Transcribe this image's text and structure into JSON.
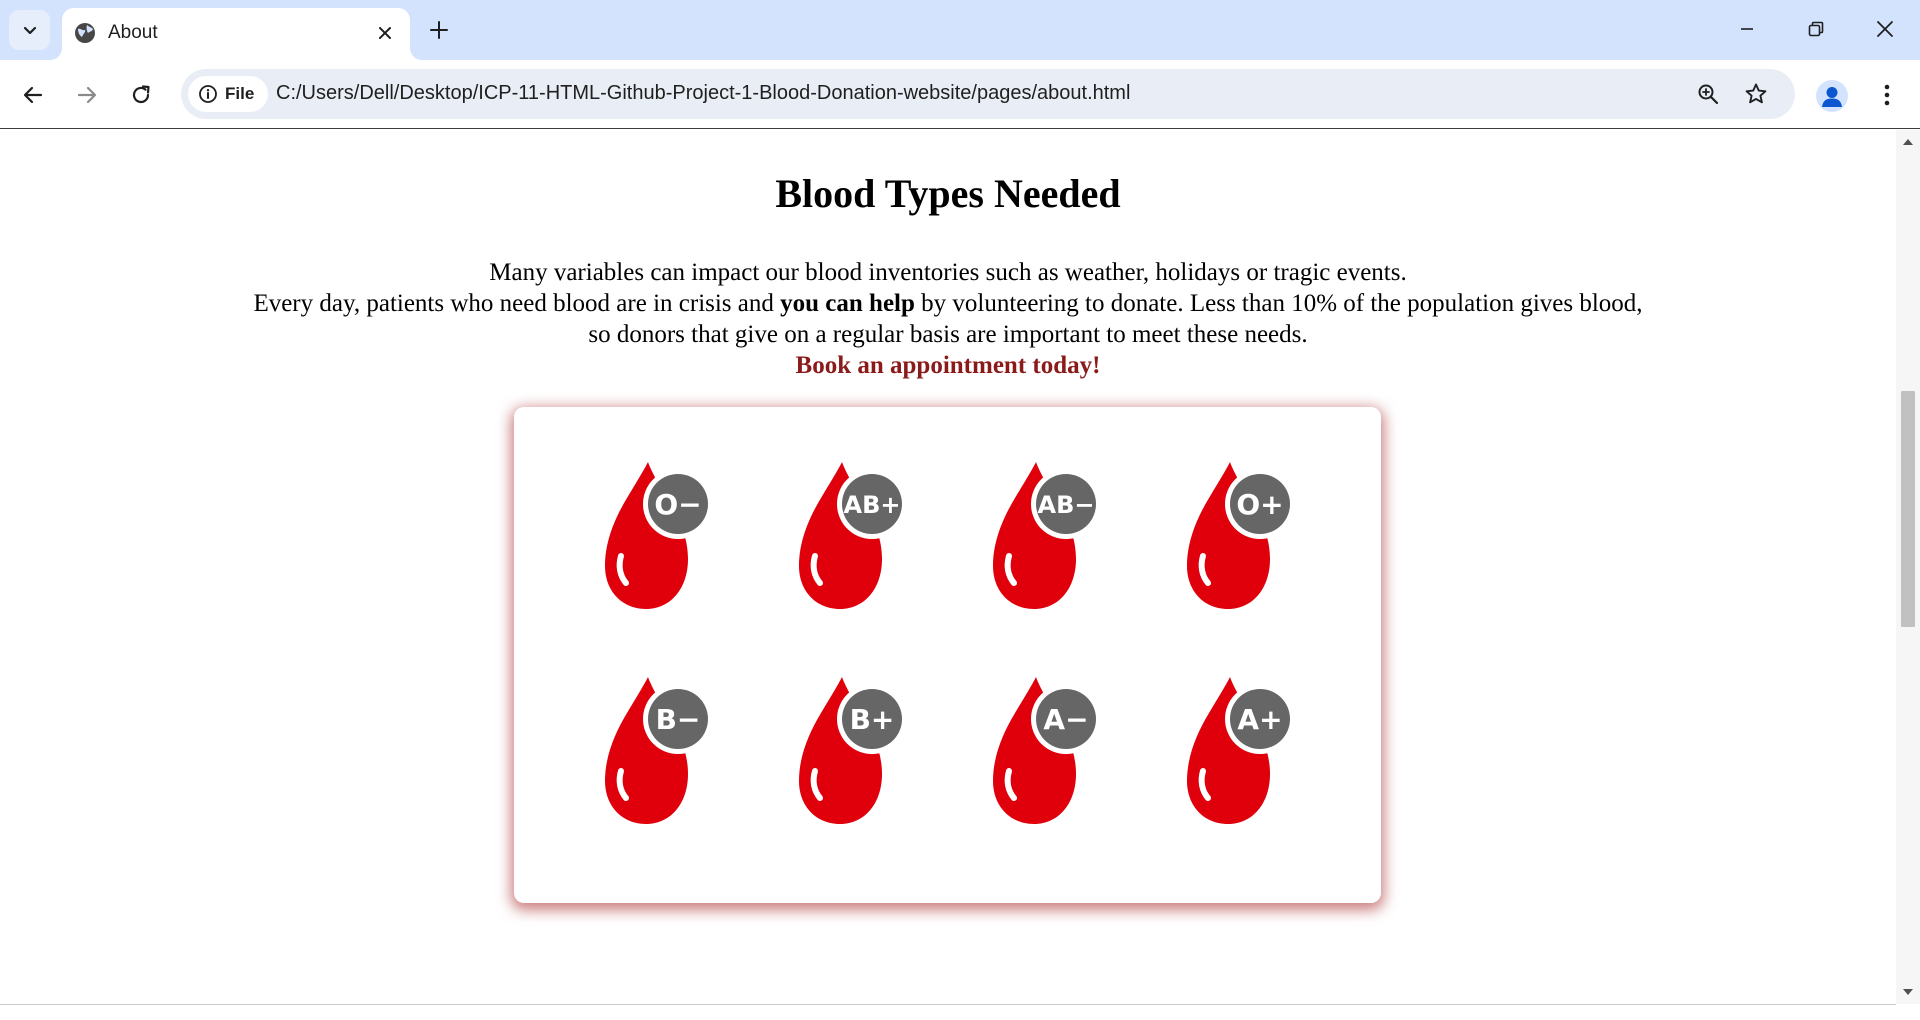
{
  "browser": {
    "tab_title": "About",
    "site_chip_label": "File",
    "url": "C:/Users/Dell/Desktop/ICP-11-HTML-Github-Project-1-Blood-Donation-website/pages/about.html"
  },
  "page": {
    "heading": "Blood Types Needed",
    "intro_line1": "Many variables can impact our blood inventories such as weather, holidays or tragic events.",
    "intro_line2_start": "Every day, patients who need blood are in crisis and ",
    "intro_line2_bold": "you can help",
    "intro_line2_end": " by volunteering to donate. Less than 10% of the population gives blood,",
    "intro_line3": "so donors that give on a regular basis are important to meet these needs.",
    "cta": "Book an appointment today!"
  },
  "blood_types": [
    "O−",
    "AB+",
    "AB−",
    "O+",
    "B−",
    "B+",
    "A−",
    "A+"
  ],
  "colors": {
    "drop_red": "#e0000b",
    "badge_gray": "#666666",
    "cta_red": "#8b1a1a",
    "title_bar": "#d3e3fd"
  }
}
